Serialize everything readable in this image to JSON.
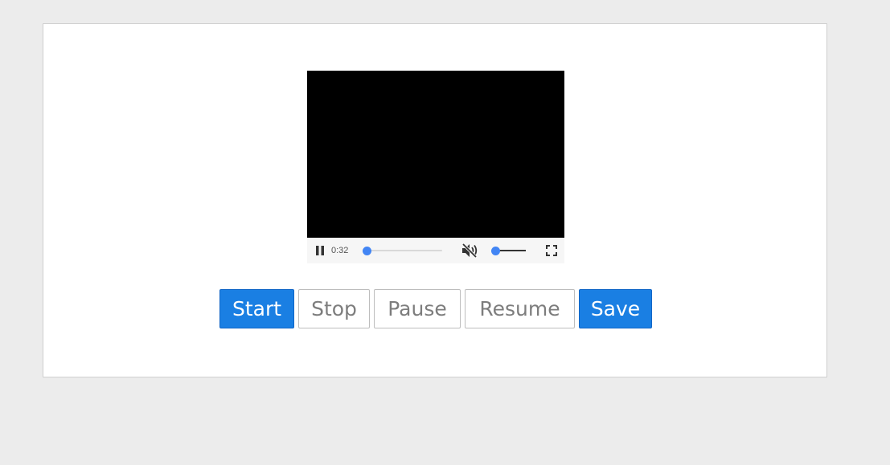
{
  "player": {
    "current_time": "0:32",
    "progress": 0.0,
    "muted": true,
    "volume": 0.0,
    "accent_color": "#4285f4",
    "icons": {
      "play_pause": "pause-icon",
      "mute": "muted-speaker-icon",
      "fullscreen": "fullscreen-icon"
    }
  },
  "buttons": {
    "start": "Start",
    "stop": "Stop",
    "pause": "Pause",
    "resume": "Resume",
    "save": "Save"
  },
  "colors": {
    "primary": "#1a7fe3",
    "background": "#ececec",
    "card": "#ffffff"
  }
}
